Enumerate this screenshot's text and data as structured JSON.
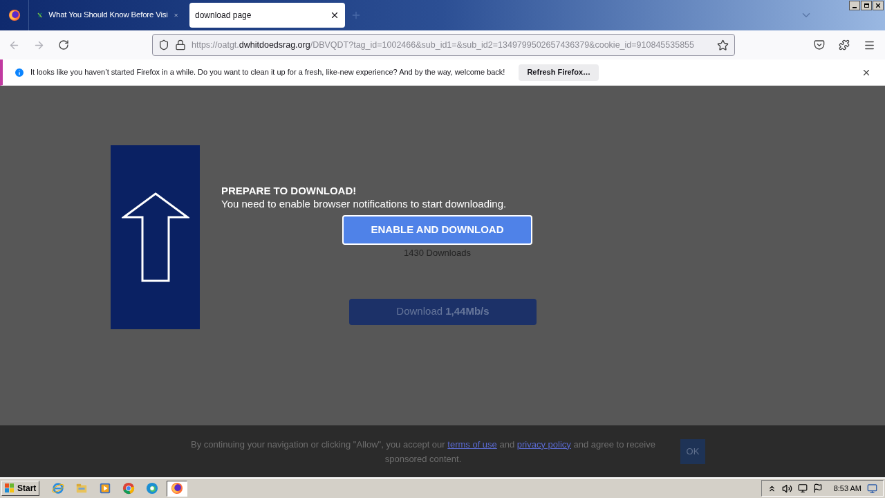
{
  "tabs": [
    {
      "title": "What You Should Know Before Visi",
      "selected": false
    },
    {
      "title": "download page",
      "selected": true
    }
  ],
  "address": {
    "prefix": "https://oatgt.",
    "host": "dwhitdoedsrag.org",
    "path": "/DBVQDT?tag_id=1002466&sub_id1=&sub_id2=1349799502657436379&cookie_id=910845535855"
  },
  "notification": {
    "text": "It looks like you haven’t started Firefox in a while. Do you want to clean it up for a fresh, like-new experience? And by the way, welcome back!",
    "button": "Refresh Firefox…"
  },
  "page": {
    "heading": "PREPARE TO DOWNLOAD!",
    "subtext": "You need to enable browser notifications to start downloading.",
    "enable_button": "ENABLE AND DOWNLOAD",
    "downloads": "1430 Downloads",
    "download_button": "Download **1,44Mb/s**"
  },
  "consent": {
    "before": "By continuing your navigation or clicking \"Allow\", you accept our",
    "link1": "terms of use",
    "middle": "and",
    "link2": "privacy policy",
    "after": "and agree to receive sponsored content.",
    "ok": "OK"
  },
  "taskbar": {
    "start": "Start",
    "apps": [
      {
        "kind": "ie",
        "active": false
      },
      {
        "kind": "folder",
        "active": false
      },
      {
        "kind": "media",
        "active": false
      },
      {
        "kind": "chrome",
        "active": false
      },
      {
        "kind": "edge",
        "active": false
      },
      {
        "kind": "firefox",
        "active": true
      }
    ],
    "clock": "8:53 AM"
  }
}
